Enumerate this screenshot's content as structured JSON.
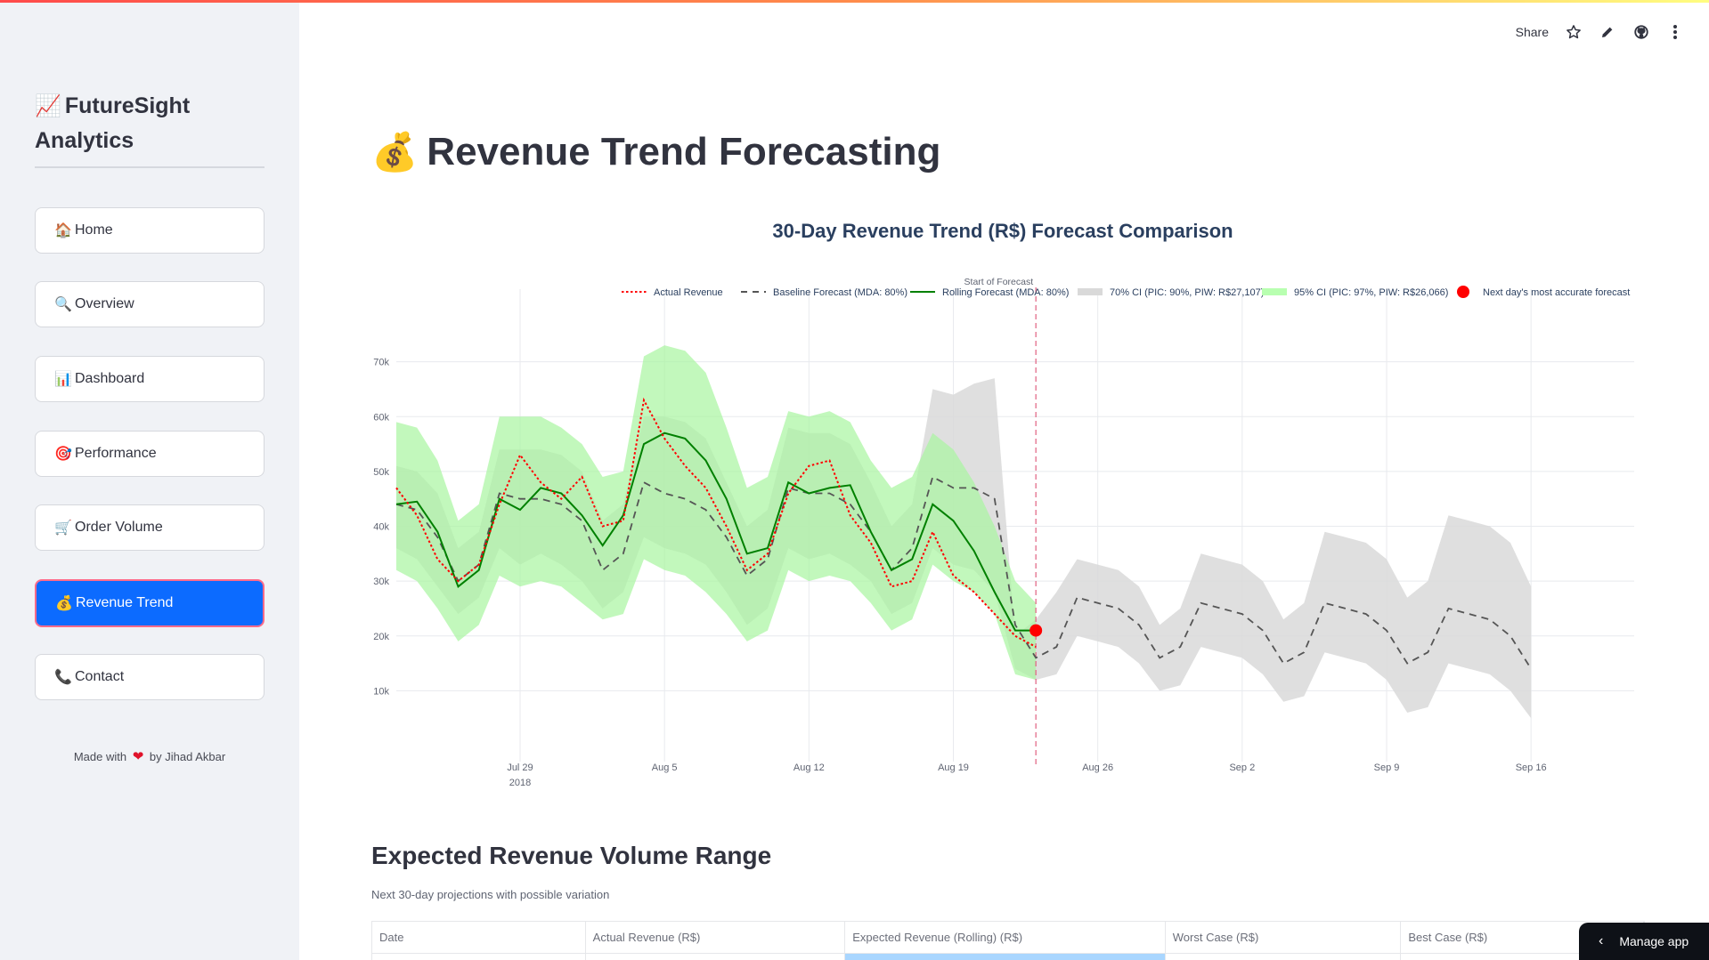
{
  "topbar": {
    "accent_gradient": [
      "#ff4b4b",
      "#fffd80"
    ]
  },
  "toolbar": {
    "share_label": "Share",
    "icons": [
      "star-icon",
      "edit-icon",
      "github-icon",
      "more-vertical-icon"
    ]
  },
  "sidebar": {
    "brand": {
      "icon": "📈",
      "title": "FutureSight Analytics"
    },
    "items": [
      {
        "icon": "🏠",
        "label": "Home",
        "active": false
      },
      {
        "icon": "🔍",
        "label": "Overview",
        "active": false
      },
      {
        "icon": "📊",
        "label": "Dashboard",
        "active": false
      },
      {
        "icon": "🎯",
        "label": "Performance",
        "active": false
      },
      {
        "icon": "🛒",
        "label": "Order Volume",
        "active": false
      },
      {
        "icon": "💰",
        "label": "Revenue Trend",
        "active": true
      },
      {
        "icon": "📞",
        "label": "Contact",
        "active": false
      }
    ],
    "footer": {
      "prefix": "Made with",
      "heart": "❤",
      "suffix": "by Jihad Akbar"
    }
  },
  "page": {
    "title_icon": "💰",
    "title": "Revenue Trend Forecasting"
  },
  "chart_data": {
    "type": "line",
    "title": "30-Day Revenue Trend (R$) Forecast Comparison",
    "annotation": "Start of Forecast",
    "forecast_start": "2018-08-23",
    "x_start": "2018-07-23",
    "x_end": "2018-09-21",
    "ylim": [
      0,
      80000
    ],
    "y_ticks": [
      10000,
      20000,
      30000,
      40000,
      50000,
      60000,
      70000
    ],
    "y_tick_labels": [
      "10k",
      "20k",
      "30k",
      "40k",
      "50k",
      "60k",
      "70k"
    ],
    "x_ticks": [
      {
        "date": "2018-07-29",
        "label": "Jul 29",
        "sub": "2018"
      },
      {
        "date": "2018-08-05",
        "label": "Aug 5",
        "sub": ""
      },
      {
        "date": "2018-08-12",
        "label": "Aug 12",
        "sub": ""
      },
      {
        "date": "2018-08-19",
        "label": "Aug 19",
        "sub": ""
      },
      {
        "date": "2018-08-26",
        "label": "Aug 26",
        "sub": ""
      },
      {
        "date": "2018-09-02",
        "label": "Sep 2",
        "sub": ""
      },
      {
        "date": "2018-09-09",
        "label": "Sep 9",
        "sub": ""
      },
      {
        "date": "2018-09-16",
        "label": "Sep 16",
        "sub": ""
      }
    ],
    "legend": [
      {
        "name": "Actual Revenue",
        "style": "dotted",
        "color": "#ff0000"
      },
      {
        "name": "Baseline Forecast (MDA: 80%)",
        "style": "dashed",
        "color": "#555555"
      },
      {
        "name": "Rolling Forecast (MDA: 80%)",
        "style": "solid",
        "color": "#008000"
      },
      {
        "name": "70% CI (PIC: 90%, PIW: R$27,107)",
        "style": "band",
        "color": "#d9d9d9"
      },
      {
        "name": "95% CI (PIC: 97%, PIW: R$26,066)",
        "style": "band",
        "color": "#b8ffb0"
      },
      {
        "name": "Next day's most accurate forecast",
        "style": "marker",
        "color": "#ff0000"
      }
    ],
    "series": {
      "actual_x": [
        "2018-07-23",
        "2018-07-24",
        "2018-07-25",
        "2018-07-26",
        "2018-07-27",
        "2018-07-28",
        "2018-07-29",
        "2018-07-30",
        "2018-07-31",
        "2018-08-01",
        "2018-08-02",
        "2018-08-03",
        "2018-08-04",
        "2018-08-05",
        "2018-08-06",
        "2018-08-07",
        "2018-08-08",
        "2018-08-09",
        "2018-08-10",
        "2018-08-11",
        "2018-08-12",
        "2018-08-13",
        "2018-08-14",
        "2018-08-15",
        "2018-08-16",
        "2018-08-17",
        "2018-08-18",
        "2018-08-19",
        "2018-08-20",
        "2018-08-21",
        "2018-08-22",
        "2018-08-23"
      ],
      "actual": [
        47000,
        42000,
        34000,
        30000,
        33000,
        44000,
        53000,
        48000,
        45000,
        49000,
        40000,
        41000,
        63000,
        56000,
        51000,
        47000,
        40000,
        32000,
        35000,
        46000,
        51000,
        52000,
        42000,
        37000,
        29000,
        30000,
        39000,
        31000,
        28000,
        24000,
        20000,
        18000
      ],
      "baseline_x": [
        "2018-07-23",
        "2018-07-24",
        "2018-07-25",
        "2018-07-26",
        "2018-07-27",
        "2018-07-28",
        "2018-07-29",
        "2018-07-30",
        "2018-07-31",
        "2018-08-01",
        "2018-08-02",
        "2018-08-03",
        "2018-08-04",
        "2018-08-05",
        "2018-08-06",
        "2018-08-07",
        "2018-08-08",
        "2018-08-09",
        "2018-08-10",
        "2018-08-11",
        "2018-08-12",
        "2018-08-13",
        "2018-08-14",
        "2018-08-15",
        "2018-08-16",
        "2018-08-17",
        "2018-08-18",
        "2018-08-19",
        "2018-08-20",
        "2018-08-21",
        "2018-08-22",
        "2018-08-23",
        "2018-08-24",
        "2018-08-25",
        "2018-08-26",
        "2018-08-27",
        "2018-08-28",
        "2018-08-29",
        "2018-08-30",
        "2018-08-31",
        "2018-09-01",
        "2018-09-02",
        "2018-09-03",
        "2018-09-04",
        "2018-09-05",
        "2018-09-06",
        "2018-09-07",
        "2018-09-08",
        "2018-09-09",
        "2018-09-10",
        "2018-09-11",
        "2018-09-12",
        "2018-09-13",
        "2018-09-14",
        "2018-09-15",
        "2018-09-16",
        "2018-09-17",
        "2018-09-18",
        "2018-09-19",
        "2018-09-20",
        "2018-09-21"
      ],
      "baseline": [
        44000,
        43000,
        38000,
        30000,
        33000,
        46000,
        45000,
        45000,
        44000,
        41000,
        32000,
        35000,
        48000,
        46000,
        45000,
        43000,
        38000,
        31000,
        34000,
        47000,
        46000,
        46000,
        44000,
        39000,
        32000,
        36000,
        49000,
        47000,
        47000,
        45000,
        22000,
        16000,
        18000,
        27000,
        26000,
        25000,
        22000,
        16000,
        18000,
        26000,
        25000,
        24000,
        21000,
        15000,
        17000,
        26000,
        25000,
        24000,
        21000,
        15000,
        17000,
        25000,
        24000,
        23000,
        20000,
        14000
      ],
      "rolling_x": [
        "2018-07-23",
        "2018-07-24",
        "2018-07-25",
        "2018-07-26",
        "2018-07-27",
        "2018-07-28",
        "2018-07-29",
        "2018-07-30",
        "2018-07-31",
        "2018-08-01",
        "2018-08-02",
        "2018-08-03",
        "2018-08-04",
        "2018-08-05",
        "2018-08-06",
        "2018-08-07",
        "2018-08-08",
        "2018-08-09",
        "2018-08-10",
        "2018-08-11",
        "2018-08-12",
        "2018-08-13",
        "2018-08-14",
        "2018-08-15",
        "2018-08-16",
        "2018-08-17",
        "2018-08-18",
        "2018-08-19",
        "2018-08-20",
        "2018-08-21",
        "2018-08-22",
        "2018-08-23"
      ],
      "rolling": [
        44000,
        44500,
        39000,
        29000,
        32000,
        45000,
        43000,
        47000,
        46000,
        42000,
        36500,
        42000,
        55000,
        57000,
        56000,
        52000,
        45000,
        35000,
        36000,
        48000,
        46000,
        47000,
        47500,
        39000,
        32000,
        34000,
        44000,
        41000,
        35500,
        28000,
        21000,
        21000
      ],
      "ci70_lower": [
        36000,
        34000,
        29000,
        24000,
        27000,
        36000,
        33000,
        35000,
        33000,
        30000,
        25000,
        28000,
        38000,
        36000,
        35000,
        33000,
        28000,
        22000,
        25000,
        36000,
        34000,
        35000,
        33000,
        30000,
        24000,
        26000,
        36000,
        33000,
        32000,
        28000,
        14000,
        12000,
        13000,
        20000,
        19000,
        18000,
        15000,
        10000,
        11000,
        18000,
        17000,
        16000,
        13000,
        8000,
        9000,
        17000,
        16000,
        15000,
        12000,
        6000,
        7000,
        15000,
        14000,
        13000,
        10000,
        5000
      ],
      "ci70_upper": [
        51000,
        50000,
        46000,
        36000,
        39000,
        54000,
        54000,
        54000,
        53000,
        50000,
        41000,
        44000,
        60000,
        60000,
        59000,
        56000,
        48000,
        40000,
        43000,
        58000,
        57000,
        57000,
        55000,
        48000,
        40000,
        44000,
        65000,
        64000,
        66000,
        67000,
        20000,
        23000,
        28000,
        34000,
        33000,
        32000,
        29000,
        22000,
        25000,
        35000,
        34000,
        33000,
        30000,
        23000,
        26000,
        39000,
        38000,
        37000,
        34000,
        27000,
        30000,
        42000,
        41000,
        40000,
        37000,
        29000
      ],
      "ci95_lower": [
        32000,
        30000,
        25000,
        19000,
        22000,
        31000,
        29000,
        30000,
        29000,
        26000,
        23000,
        24000,
        34000,
        32000,
        31000,
        28000,
        24000,
        19000,
        21000,
        32000,
        30000,
        31000,
        30000,
        26000,
        21000,
        23000,
        33000,
        30000,
        28000,
        24000,
        13000,
        12000
      ],
      "ci95_upper": [
        59000,
        58000,
        52000,
        41000,
        44000,
        60000,
        60000,
        60000,
        58000,
        55000,
        49000,
        50000,
        71000,
        73000,
        72000,
        68000,
        58000,
        47000,
        49000,
        61000,
        60000,
        61000,
        59000,
        52000,
        47000,
        49000,
        57000,
        54000,
        48000,
        40000,
        30000,
        26000
      ],
      "next_day_point": {
        "x": "2018-08-23",
        "y": 21000
      }
    }
  },
  "section": {
    "title": "Expected Revenue Volume Range",
    "subtitle": "Next 30-day projections with possible variation"
  },
  "table": {
    "columns": [
      "Date",
      "Actual Revenue (R$)",
      "Expected Revenue (Rolling) (R$)",
      "Worst Case (R$)",
      "Best Case (R$)"
    ]
  },
  "manage_app": {
    "label": "Manage app"
  }
}
